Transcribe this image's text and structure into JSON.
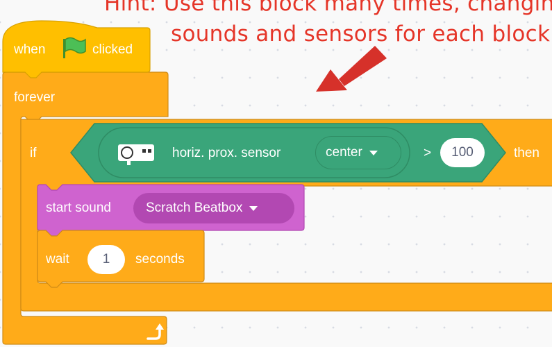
{
  "hint": {
    "line1": "Hint: Use this block many times, changing",
    "line2": "sounds and sensors for each block!"
  },
  "hat_block": {
    "prefix": "when",
    "icon": "green-flag-icon",
    "suffix": "clicked"
  },
  "forever_block": {
    "label": "forever",
    "loop_icon": "loop-arrow-icon"
  },
  "if_block": {
    "if_label": "if",
    "then_label": "then",
    "condition": {
      "operator": ">",
      "value": "100",
      "sensor_icon": "proximity-sensor-icon",
      "sensor_label": "horiz. prox. sensor",
      "sensor_option": "center"
    }
  },
  "sound_block": {
    "label": "start sound",
    "sound_option": "Scratch Beatbox"
  },
  "wait_block": {
    "prefix": "wait",
    "value": "1",
    "suffix": "seconds"
  },
  "colors": {
    "events": "#ffbf00",
    "control": "#ffab19",
    "control_border": "#cf8b17",
    "sensing": "#3aa57a",
    "sensing_dark": "#2f8c64",
    "sound": "#cf63cf",
    "sound_dark": "#b248b2",
    "hint_text": "#e53528",
    "arrow": "#d6312a"
  }
}
